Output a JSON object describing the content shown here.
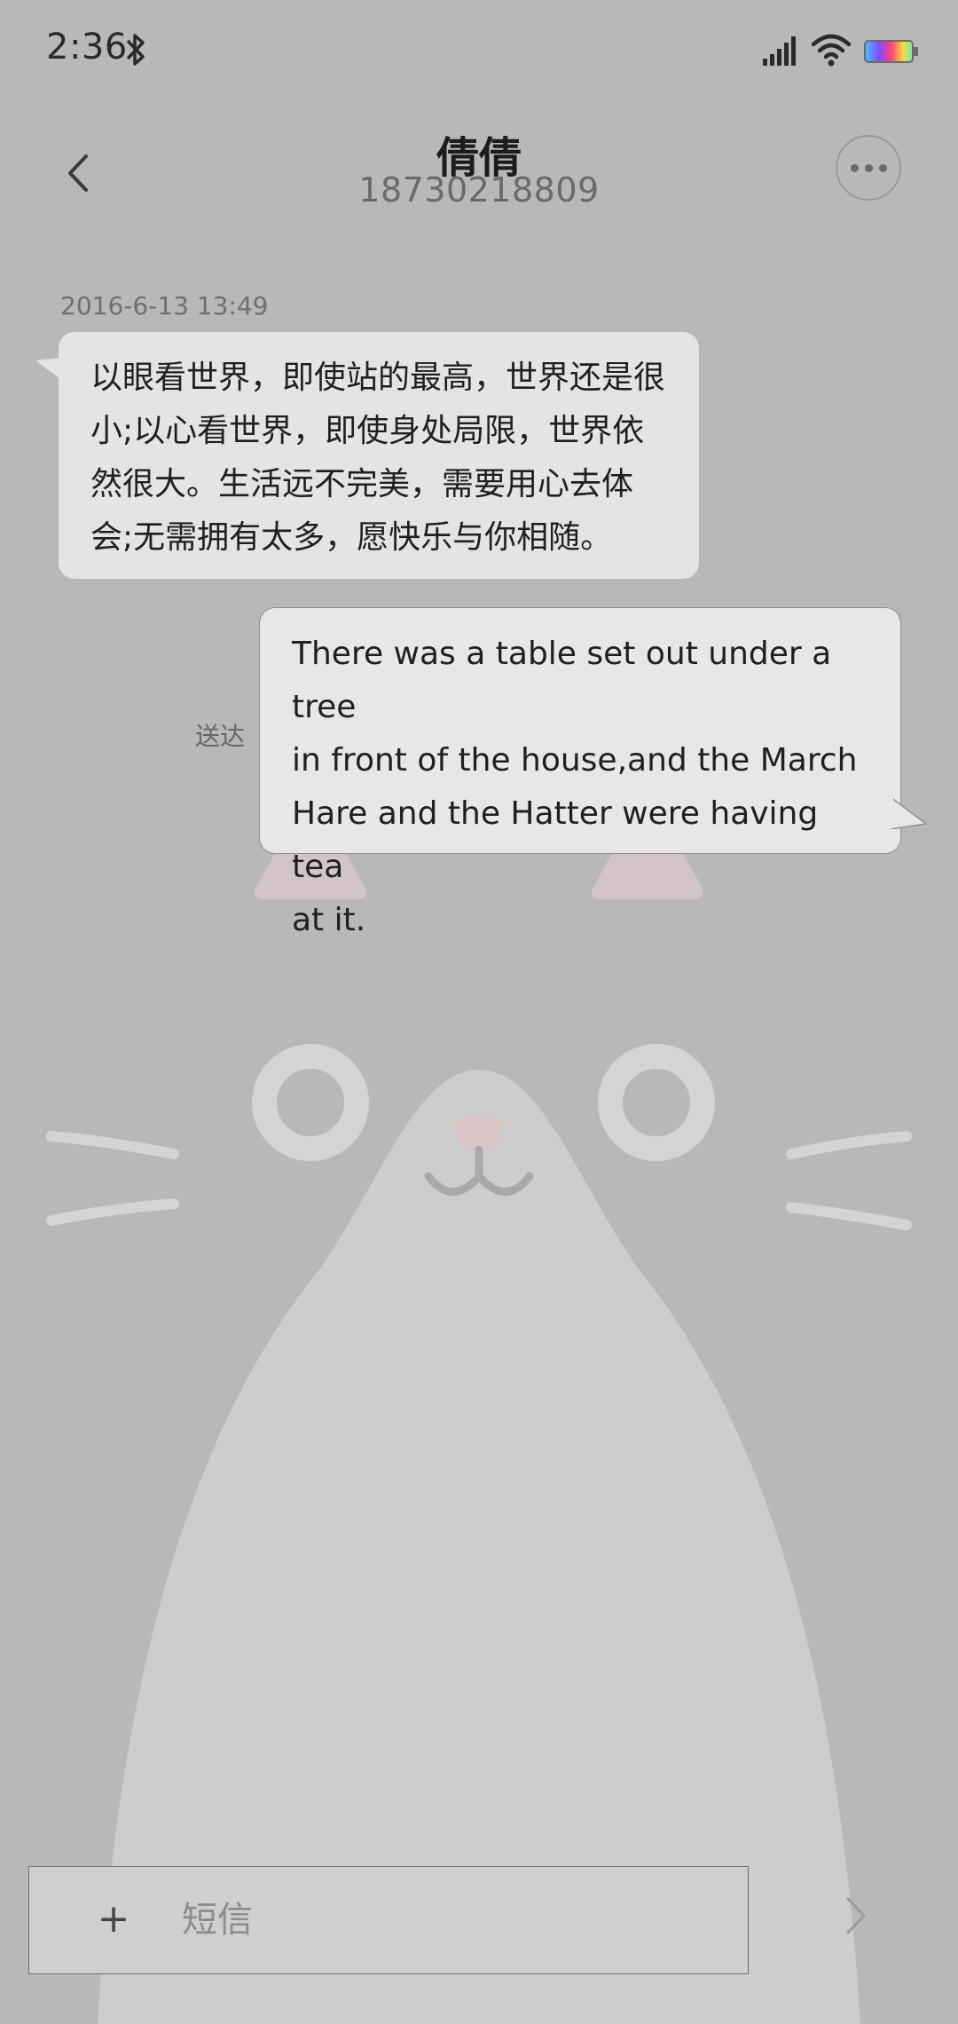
{
  "status_bar": {
    "time": "2:36",
    "icons": [
      "bluetooth-icon",
      "signal-icon",
      "wifi-icon",
      "battery-icon"
    ]
  },
  "header": {
    "contact_name": "倩倩",
    "contact_number": "18730218809",
    "icons": [
      "back-arrow-icon",
      "more-options-icon"
    ]
  },
  "conversation": {
    "timestamp": "2016-6-13 13:49",
    "incoming_lines": [
      "以眼看世界，即使站的最高，世界还是很",
      "小;以心看世界，即使身处局限，世界依",
      "然很大。生活远不完美，需要用心去体",
      "会;无需拥有太多，愿快乐与你相随。"
    ],
    "outgoing_lines": [
      "There was a table set out under a tree",
      "in front of the house,and the March",
      "Hare and the Hatter were having tea",
      "at it."
    ],
    "delivery_status": "送达"
  },
  "composer": {
    "attach_symbol": "+",
    "placeholder": "短信",
    "icons": [
      "plus-icon",
      "send-arrow-icon"
    ]
  },
  "colors": {
    "background": "#b8b8b8",
    "bubble": "#e4e4e4",
    "cat_body": "#cdcdcd",
    "cat_nose": "#d9c4c6"
  }
}
